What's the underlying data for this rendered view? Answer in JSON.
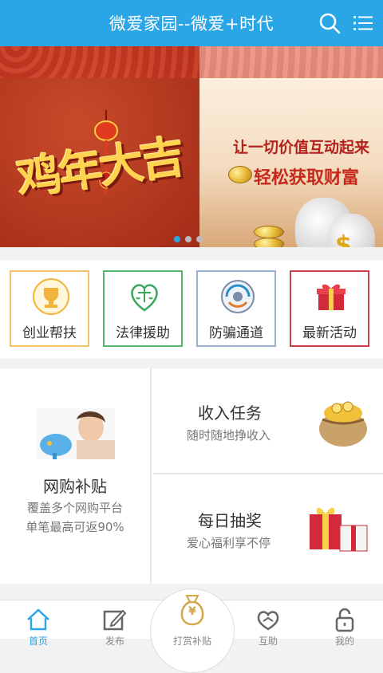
{
  "header": {
    "title": "微爱家园--微爱+时代",
    "search_icon": "search-icon",
    "menu_icon": "menu-icon"
  },
  "banner": {
    "calligraphy": "鸡年大吉",
    "slogan_line1": "让一切价值互动起来",
    "slogan_line2": "轻松获取财富",
    "currency_symbol": "$",
    "slides": 3,
    "active_slide": 1
  },
  "categories": [
    {
      "label": "创业帮扶",
      "icon": "trophy-icon",
      "border": "#f2c46a"
    },
    {
      "label": "法律援助",
      "icon": "scales-heart-icon",
      "border": "#55b86a"
    },
    {
      "label": "防骗通道",
      "icon": "shield-globe-icon",
      "border": "#9ab1d6"
    },
    {
      "label": "最新活动",
      "icon": "gift-icon",
      "border": "#c8414a"
    }
  ],
  "promos": {
    "shopping": {
      "title": "网购补贴",
      "line1": "覆盖多个网购平台",
      "line2": "单笔最高可返90%"
    },
    "income": {
      "title": "收入任务",
      "subtitle": "随时随地挣收入"
    },
    "lottery": {
      "title": "每日抽奖",
      "subtitle": "爱心福利享不停"
    }
  },
  "tabbar": {
    "items": [
      {
        "label": "首页",
        "icon": "home-icon",
        "active": true
      },
      {
        "label": "发布",
        "icon": "edit-icon"
      },
      {
        "label": "打赏补贴",
        "icon": "money-bag-icon"
      },
      {
        "label": "互助",
        "icon": "handshake-icon"
      },
      {
        "label": "我的",
        "icon": "lock-icon"
      }
    ],
    "center_symbol": "¥"
  },
  "colors": {
    "accent": "#2aa6e6",
    "banner_red": "#a8301a",
    "gold": "#ffd34d"
  }
}
